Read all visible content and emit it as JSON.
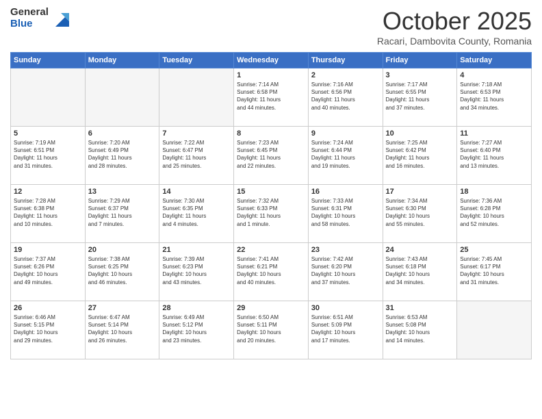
{
  "header": {
    "logo_general": "General",
    "logo_blue": "Blue",
    "month_title": "October 2025",
    "location": "Racari, Dambovita County, Romania"
  },
  "days_of_week": [
    "Sunday",
    "Monday",
    "Tuesday",
    "Wednesday",
    "Thursday",
    "Friday",
    "Saturday"
  ],
  "weeks": [
    [
      {
        "num": "",
        "info": "",
        "empty": true
      },
      {
        "num": "",
        "info": "",
        "empty": true
      },
      {
        "num": "",
        "info": "",
        "empty": true
      },
      {
        "num": "1",
        "info": "Sunrise: 7:14 AM\nSunset: 6:58 PM\nDaylight: 11 hours\nand 44 minutes."
      },
      {
        "num": "2",
        "info": "Sunrise: 7:16 AM\nSunset: 6:56 PM\nDaylight: 11 hours\nand 40 minutes."
      },
      {
        "num": "3",
        "info": "Sunrise: 7:17 AM\nSunset: 6:55 PM\nDaylight: 11 hours\nand 37 minutes."
      },
      {
        "num": "4",
        "info": "Sunrise: 7:18 AM\nSunset: 6:53 PM\nDaylight: 11 hours\nand 34 minutes."
      }
    ],
    [
      {
        "num": "5",
        "info": "Sunrise: 7:19 AM\nSunset: 6:51 PM\nDaylight: 11 hours\nand 31 minutes."
      },
      {
        "num": "6",
        "info": "Sunrise: 7:20 AM\nSunset: 6:49 PM\nDaylight: 11 hours\nand 28 minutes."
      },
      {
        "num": "7",
        "info": "Sunrise: 7:22 AM\nSunset: 6:47 PM\nDaylight: 11 hours\nand 25 minutes."
      },
      {
        "num": "8",
        "info": "Sunrise: 7:23 AM\nSunset: 6:45 PM\nDaylight: 11 hours\nand 22 minutes."
      },
      {
        "num": "9",
        "info": "Sunrise: 7:24 AM\nSunset: 6:44 PM\nDaylight: 11 hours\nand 19 minutes."
      },
      {
        "num": "10",
        "info": "Sunrise: 7:25 AM\nSunset: 6:42 PM\nDaylight: 11 hours\nand 16 minutes."
      },
      {
        "num": "11",
        "info": "Sunrise: 7:27 AM\nSunset: 6:40 PM\nDaylight: 11 hours\nand 13 minutes."
      }
    ],
    [
      {
        "num": "12",
        "info": "Sunrise: 7:28 AM\nSunset: 6:38 PM\nDaylight: 11 hours\nand 10 minutes."
      },
      {
        "num": "13",
        "info": "Sunrise: 7:29 AM\nSunset: 6:37 PM\nDaylight: 11 hours\nand 7 minutes."
      },
      {
        "num": "14",
        "info": "Sunrise: 7:30 AM\nSunset: 6:35 PM\nDaylight: 11 hours\nand 4 minutes."
      },
      {
        "num": "15",
        "info": "Sunrise: 7:32 AM\nSunset: 6:33 PM\nDaylight: 11 hours\nand 1 minute."
      },
      {
        "num": "16",
        "info": "Sunrise: 7:33 AM\nSunset: 6:31 PM\nDaylight: 10 hours\nand 58 minutes."
      },
      {
        "num": "17",
        "info": "Sunrise: 7:34 AM\nSunset: 6:30 PM\nDaylight: 10 hours\nand 55 minutes."
      },
      {
        "num": "18",
        "info": "Sunrise: 7:36 AM\nSunset: 6:28 PM\nDaylight: 10 hours\nand 52 minutes."
      }
    ],
    [
      {
        "num": "19",
        "info": "Sunrise: 7:37 AM\nSunset: 6:26 PM\nDaylight: 10 hours\nand 49 minutes."
      },
      {
        "num": "20",
        "info": "Sunrise: 7:38 AM\nSunset: 6:25 PM\nDaylight: 10 hours\nand 46 minutes."
      },
      {
        "num": "21",
        "info": "Sunrise: 7:39 AM\nSunset: 6:23 PM\nDaylight: 10 hours\nand 43 minutes."
      },
      {
        "num": "22",
        "info": "Sunrise: 7:41 AM\nSunset: 6:21 PM\nDaylight: 10 hours\nand 40 minutes."
      },
      {
        "num": "23",
        "info": "Sunrise: 7:42 AM\nSunset: 6:20 PM\nDaylight: 10 hours\nand 37 minutes."
      },
      {
        "num": "24",
        "info": "Sunrise: 7:43 AM\nSunset: 6:18 PM\nDaylight: 10 hours\nand 34 minutes."
      },
      {
        "num": "25",
        "info": "Sunrise: 7:45 AM\nSunset: 6:17 PM\nDaylight: 10 hours\nand 31 minutes."
      }
    ],
    [
      {
        "num": "26",
        "info": "Sunrise: 6:46 AM\nSunset: 5:15 PM\nDaylight: 10 hours\nand 29 minutes."
      },
      {
        "num": "27",
        "info": "Sunrise: 6:47 AM\nSunset: 5:14 PM\nDaylight: 10 hours\nand 26 minutes."
      },
      {
        "num": "28",
        "info": "Sunrise: 6:49 AM\nSunset: 5:12 PM\nDaylight: 10 hours\nand 23 minutes."
      },
      {
        "num": "29",
        "info": "Sunrise: 6:50 AM\nSunset: 5:11 PM\nDaylight: 10 hours\nand 20 minutes."
      },
      {
        "num": "30",
        "info": "Sunrise: 6:51 AM\nSunset: 5:09 PM\nDaylight: 10 hours\nand 17 minutes."
      },
      {
        "num": "31",
        "info": "Sunrise: 6:53 AM\nSunset: 5:08 PM\nDaylight: 10 hours\nand 14 minutes."
      },
      {
        "num": "",
        "info": "",
        "empty": true
      }
    ]
  ]
}
